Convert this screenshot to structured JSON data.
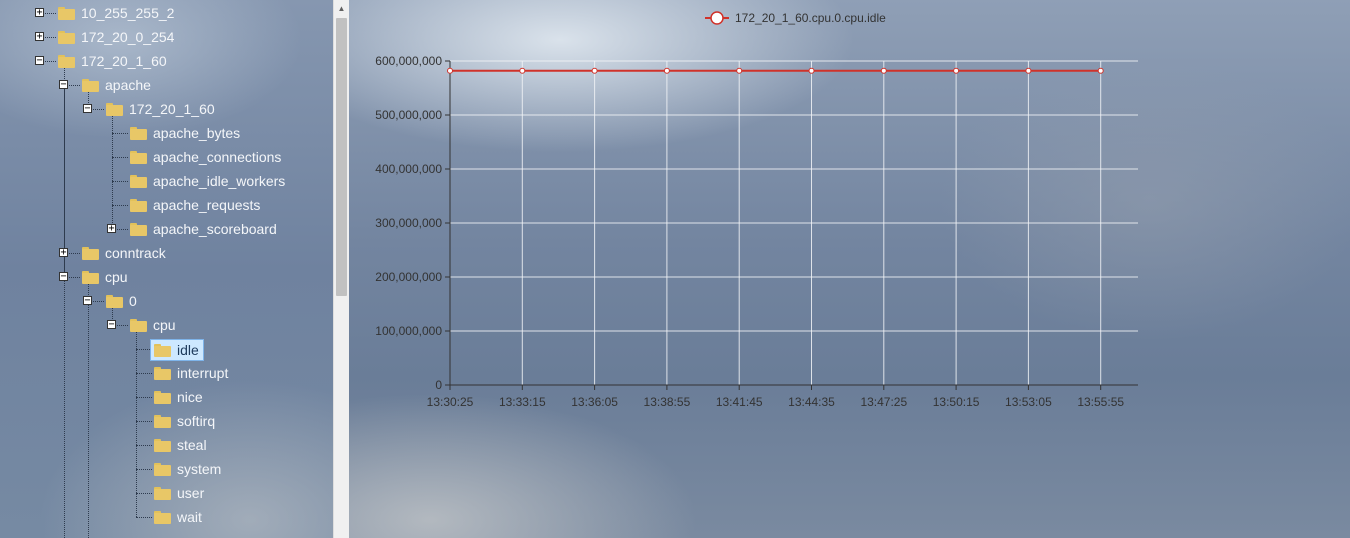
{
  "tree": {
    "nodes": [
      {
        "label": "10_255_255_2",
        "toggle": "+",
        "depth": 1
      },
      {
        "label": "172_20_0_254",
        "toggle": "+",
        "depth": 1
      },
      {
        "label": "172_20_1_60",
        "toggle": "−",
        "depth": 1
      },
      {
        "label": "apache",
        "toggle": "−",
        "depth": 2
      },
      {
        "label": "172_20_1_60",
        "toggle": "−",
        "depth": 3
      },
      {
        "label": "apache_bytes",
        "toggle": "",
        "depth": 4
      },
      {
        "label": "apache_connections",
        "toggle": "",
        "depth": 4
      },
      {
        "label": "apache_idle_workers",
        "toggle": "",
        "depth": 4
      },
      {
        "label": "apache_requests",
        "toggle": "",
        "depth": 4
      },
      {
        "label": "apache_scoreboard",
        "toggle": "+",
        "depth": 4
      },
      {
        "label": "conntrack",
        "toggle": "+",
        "depth": 2
      },
      {
        "label": "cpu",
        "toggle": "−",
        "depth": 2
      },
      {
        "label": "0",
        "toggle": "−",
        "depth": 3
      },
      {
        "label": "cpu",
        "toggle": "−",
        "depth": 4
      },
      {
        "label": "idle",
        "toggle": "",
        "depth": 5,
        "selected": true
      },
      {
        "label": "interrupt",
        "toggle": "",
        "depth": 5
      },
      {
        "label": "nice",
        "toggle": "",
        "depth": 5
      },
      {
        "label": "softirq",
        "toggle": "",
        "depth": 5
      },
      {
        "label": "steal",
        "toggle": "",
        "depth": 5
      },
      {
        "label": "system",
        "toggle": "",
        "depth": 5
      },
      {
        "label": "user",
        "toggle": "",
        "depth": 5
      },
      {
        "label": "wait",
        "toggle": "",
        "depth": 5
      }
    ]
  },
  "chart_data": {
    "type": "line",
    "title": "",
    "xlabel": "",
    "ylabel": "",
    "legend_position": "top",
    "categories": [
      "13:30:25",
      "13:33:15",
      "13:36:05",
      "13:38:55",
      "13:41:45",
      "13:44:35",
      "13:47:25",
      "13:50:15",
      "13:53:05",
      "13:55:55"
    ],
    "series": [
      {
        "name": "172_20_1_60.cpu.0.cpu.idle",
        "color": "#d0322a",
        "values": [
          582000000,
          582000000,
          582000000,
          582000000,
          582000000,
          582000000,
          582000000,
          582000000,
          582000000,
          582000000
        ]
      }
    ],
    "ylim": [
      0,
      600000000
    ],
    "yticks": [
      0,
      100000000,
      200000000,
      300000000,
      400000000,
      500000000,
      600000000
    ],
    "ytick_labels": [
      "0",
      "100,000,000",
      "200,000,000",
      "300,000,000",
      "400,000,000",
      "500,000,000",
      "600,000,000"
    ],
    "grid": true
  },
  "colors": {
    "series": "#d0322a",
    "grid": "#ffffff",
    "axis": "#333333",
    "selected_bg": "#cde8ff",
    "folder": "#e8c767"
  }
}
